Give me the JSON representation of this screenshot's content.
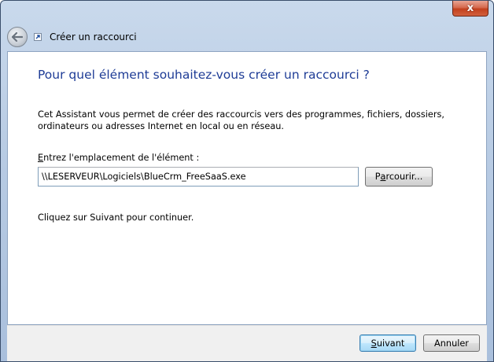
{
  "window": {
    "close_glyph": "x"
  },
  "nav": {
    "back_icon": "back-arrow-icon",
    "wizard_icon": "shortcut-icon",
    "title": "Créer un raccourci"
  },
  "main": {
    "heading": "Pour quel élément souhaitez-vous créer un raccourci ?",
    "description": "Cet Assistant vous permet de créer des raccourcis vers des programmes, fichiers, dossiers, ordinateurs ou adresses Internet en local ou en réseau.",
    "location_label_access": "E",
    "location_label_rest": "ntrez l'emplacement de l'élément :",
    "location_value": "\\\\LESERVEUR\\Logiciels\\BlueCrm_FreeSaaS.exe",
    "browse_access": "a",
    "browse_prefix": "P",
    "browse_rest": "rcourir...",
    "instruction": "Cliquez sur Suivant pour continuer."
  },
  "footer": {
    "next_access": "S",
    "next_rest": "uivant",
    "cancel_label": "Annuler"
  },
  "colors": {
    "heading": "#1e3c96",
    "frame": "#b9cce4",
    "close": "#c2401e",
    "footer_bg": "#f0f0f0"
  }
}
